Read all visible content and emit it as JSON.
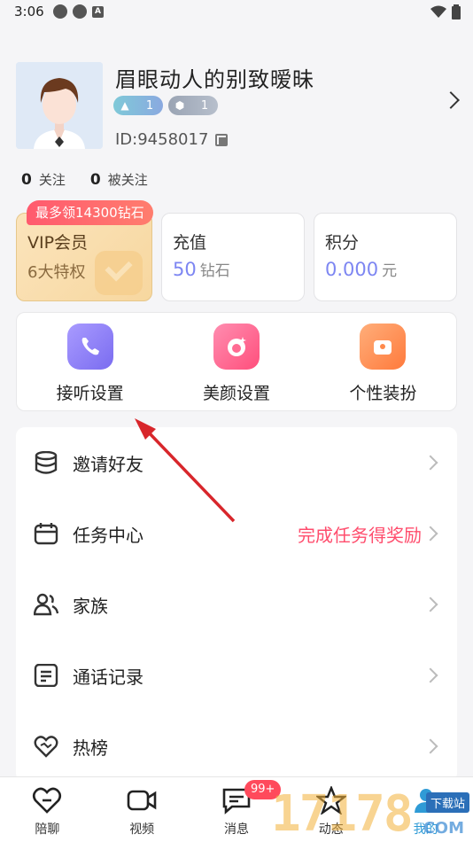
{
  "status_bar": {
    "time": "3:06"
  },
  "profile": {
    "nickname": "眉眼动人的别致暧昧",
    "level_badge": "1",
    "rank_badge": "1",
    "user_id": "ID:9458017"
  },
  "follow": {
    "following_count": "0",
    "following_label": "关注",
    "followers_count": "0",
    "followers_label": "被关注"
  },
  "cards": {
    "promo_tag": "最多领14300钻石",
    "vip": {
      "title": "VIP会员",
      "sub": "6大特权"
    },
    "recharge": {
      "title": "充值",
      "value": "50",
      "unit": "钻石"
    },
    "points": {
      "title": "积分",
      "value": "0.000",
      "unit": "元"
    }
  },
  "shortcuts": [
    {
      "label": "接听设置",
      "color": "#8a7cf5"
    },
    {
      "label": "美颜设置",
      "color": "#ff5f8e"
    },
    {
      "label": "个性装扮",
      "color": "#ff8a4c"
    }
  ],
  "menu": [
    {
      "label": "邀请好友",
      "icon": "database-icon"
    },
    {
      "label": "任务中心",
      "icon": "calendar-icon",
      "hint": "完成任务得奖励"
    },
    {
      "label": "家族",
      "icon": "users-icon"
    },
    {
      "label": "通话记录",
      "icon": "document-icon"
    },
    {
      "label": "热榜",
      "icon": "heart-icon"
    }
  ],
  "tabbar": {
    "tabs": [
      "陪聊",
      "视频",
      "消息",
      "动态",
      "我的"
    ],
    "unread_badge": "99+"
  },
  "watermark": {
    "text": "17178",
    "tag": "下载站",
    "suffix": "COM"
  },
  "colors": {
    "accent": "#7d86f2",
    "promo": "#ff5a6e",
    "hint": "#ff4d6d",
    "arrow": "#d8262b"
  }
}
